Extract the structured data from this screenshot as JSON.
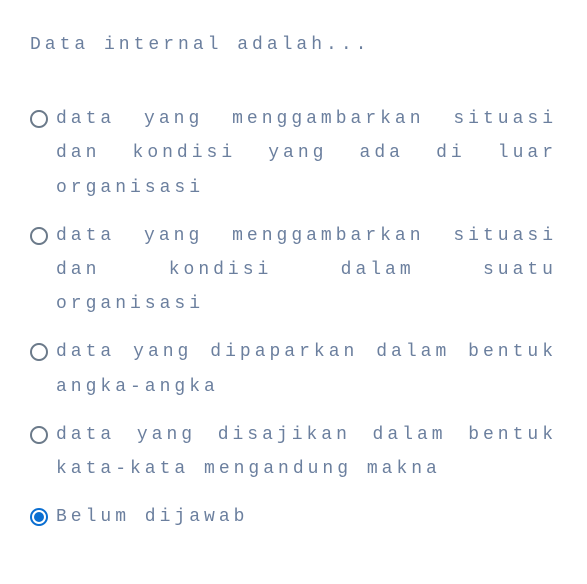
{
  "question": "Data internal adalah...",
  "options": [
    {
      "label": "data yang menggambarkan situasi dan kondisi yang ada di luar organisasi",
      "selected": false,
      "justify": true
    },
    {
      "label": "data yang menggambarkan situasi dan kondisi dalam suatu organisasi",
      "selected": false,
      "justify": true
    },
    {
      "label": "data yang dipaparkan dalam bentuk angka-angka",
      "selected": false,
      "justify": true
    },
    {
      "label": "data yang disajikan dalam bentuk kata-kata mengandung makna",
      "selected": false,
      "justify": true
    },
    {
      "label": "Belum dijawab",
      "selected": true,
      "justify": false
    }
  ]
}
